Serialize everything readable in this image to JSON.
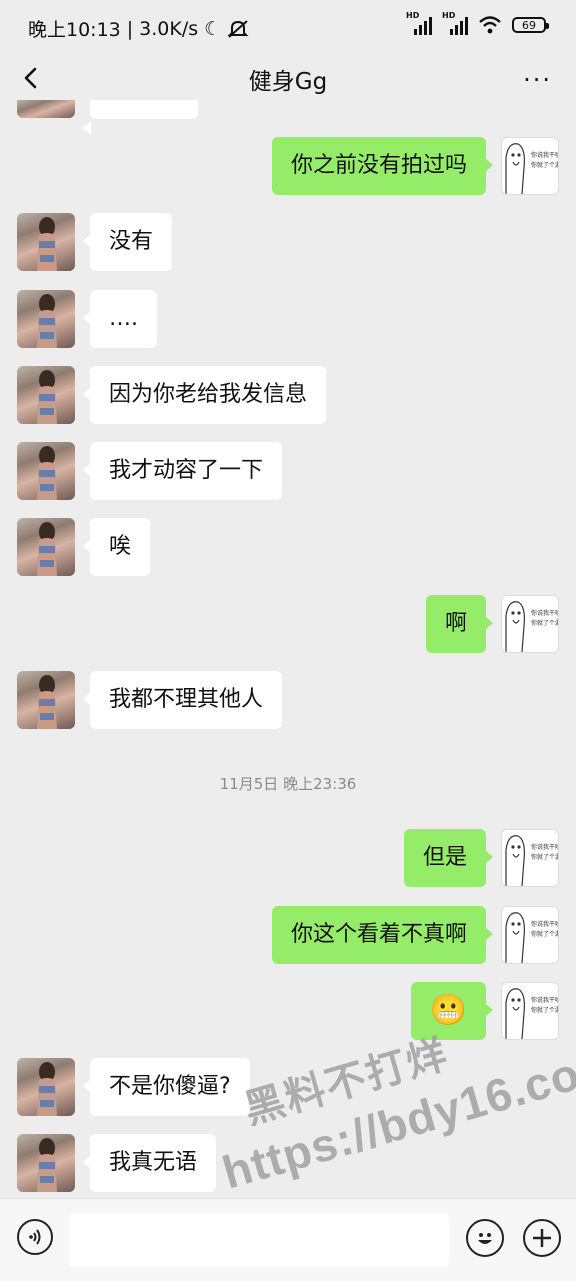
{
  "status": {
    "time": "晚上10:13",
    "speed": "3.0K/s",
    "hd1": "HD",
    "hd2": "HD",
    "battery": "69"
  },
  "nav": {
    "title": "健身Gg",
    "more": "···"
  },
  "messages": [
    {
      "side": "out",
      "text": "你之前没有拍过吗"
    },
    {
      "side": "in",
      "text": "没有"
    },
    {
      "side": "in",
      "text": "…."
    },
    {
      "side": "in",
      "text": "因为你老给我发信息"
    },
    {
      "side": "in",
      "text": "我才动容了一下"
    },
    {
      "side": "in",
      "text": "唉"
    },
    {
      "side": "out",
      "text": "啊"
    },
    {
      "side": "in",
      "text": "我都不理其他人"
    },
    {
      "side": "out",
      "text": "但是"
    },
    {
      "side": "out",
      "text": "你这个看着不真啊"
    },
    {
      "side": "out",
      "text": "emoji",
      "emoji": "😬"
    },
    {
      "side": "in",
      "text": "不是你傻逼?"
    },
    {
      "side": "in",
      "text": "我真无语"
    }
  ],
  "timestamp": "11月5日 晚上23:36",
  "sticker_text": {
    "line1": "你说我干啥",
    "line2": "你就了个漏"
  },
  "watermark": {
    "line1": "黑料不打烊",
    "line2": "https://bdy16.co"
  },
  "colors": {
    "incoming": "#ffffff",
    "outgoing": "#95ec69",
    "background": "#ededed"
  }
}
